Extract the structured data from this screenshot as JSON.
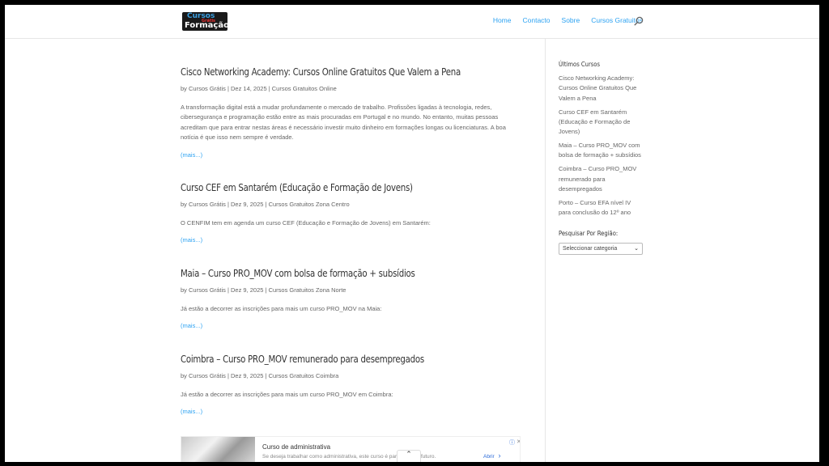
{
  "logo": {
    "line1": "Cursos",
    "line2": "Grátis",
    "line3": "Formação"
  },
  "nav": [
    "Home",
    "Contacto",
    "Sobre",
    "Cursos Gratuitos"
  ],
  "posts": [
    {
      "title": "Cisco Networking Academy: Cursos Online Gratuitos Que Valem a Pena",
      "author": "Cursos Grátis",
      "date": "Dez 14, 2025",
      "category": "Cursos Gratuitos Online",
      "excerpt": "A transformação digital está a mudar profundamente o mercado de trabalho. Profissões ligadas à tecnologia, redes, cibersegurança e programação estão entre as mais procuradas em Portugal e no mundo. No entanto, muitas pessoas acreditam que para entrar nestas áreas é necessário investir muito dinheiro em formações longas ou licenciaturas. A boa notícia é que isso nem sempre é verdade.",
      "more": "(mais...)"
    },
    {
      "title": "Curso CEF em Santarém (Educação e Formação de Jovens)",
      "author": "Cursos Grátis",
      "date": "Dez 9, 2025",
      "category": "Cursos Gratuitos Zona Centro",
      "excerpt": "O CENFIM tem em agenda um curso CEF (Educação e Formação de Jovens) em Santarém:",
      "more": "(mais...)"
    },
    {
      "title": "Maia – Curso PRO_MOV com bolsa de formação + subsídios",
      "author": "Cursos Grátis",
      "date": "Dez 9, 2025",
      "category": "Cursos Gratuitos Zona Norte",
      "excerpt": "Já estão a decorrer as inscrições para mais um curso PRO_MOV na Maia:",
      "more": "(mais...)"
    },
    {
      "title": "Coimbra – Curso PRO_MOV remunerado para desempregados",
      "author": "Cursos Grátis",
      "date": "Dez 9, 2025",
      "category": "Cursos Gratuitos Coimbra",
      "excerpt": "Já estão a decorrer as inscrições para mais um curso PRO_MOV em Coimbra:",
      "more": "(mais...)"
    }
  ],
  "meta": {
    "by": "by",
    "sep": "|"
  },
  "sidebar": {
    "recent_title": "Últimos Cursos",
    "recent": [
      "Cisco Networking Academy: Cursos Online Gratuitos Que Valem a Pena",
      "Curso CEF em Santarém (Educação e Formação de Jovens)",
      "Maia – Curso PRO_MOV com bolsa de formação + subsídios",
      "Coimbra – Curso PRO_MOV remunerado para desempregados",
      "Porto – Curso EFA nível IV para conclusão do 12º ano"
    ],
    "region_title": "Pesquisar Por Região:",
    "region_select": "Seleccionar categoria"
  },
  "ad": {
    "title": "Curso de administrativa",
    "desc": "Se deseja trabalhar como administrativa, este curso é para si... seu futuro.",
    "open": "Abrir"
  },
  "icons": {
    "search": "search-icon",
    "scroll_top": "chevron-up-icon",
    "ad_open": "chevron-right-icon"
  }
}
